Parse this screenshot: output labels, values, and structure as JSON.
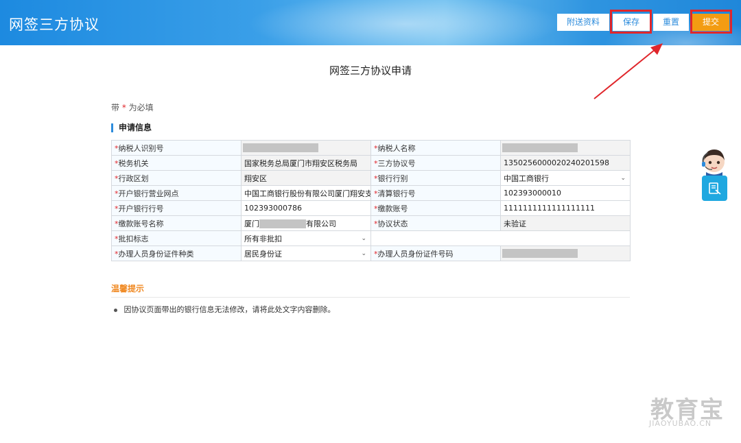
{
  "header": {
    "title": "网签三方协议",
    "buttons": {
      "attach": "附送资料",
      "save": "保存",
      "reset": "重置",
      "submit": "提交"
    }
  },
  "page": {
    "title": "网签三方协议申请",
    "required_note_prefix": "带",
    "required_star": "*",
    "required_note_suffix": "为必填",
    "section_title": "申请信息"
  },
  "form": {
    "rows": [
      [
        {
          "label": "纳税人识别号",
          "value": "",
          "masked": true,
          "readonly": true
        },
        {
          "label": "纳税人名称",
          "value": "",
          "masked": true,
          "readonly": true
        }
      ],
      [
        {
          "label": "税务机关",
          "value": "国家税务总局厦门市翔安区税务局",
          "readonly": true
        },
        {
          "label": "三方协议号",
          "value": "13502560000202402015​98",
          "readonly": true
        }
      ],
      [
        {
          "label": "行政区划",
          "value": "翔安区",
          "readonly": true
        },
        {
          "label": "银行行别",
          "value": "中国工商银行",
          "select": true
        }
      ],
      [
        {
          "label": "开户银行营业网点",
          "value": "中国工商银行股份有限公司厦门翔安支行"
        },
        {
          "label": "清算银行号",
          "value": "102393000010"
        }
      ],
      [
        {
          "label": "开户银行行号",
          "value": "102393000786"
        },
        {
          "label": "缴款账号",
          "value": "1111111111111111111"
        }
      ],
      [
        {
          "label": "缴款账号名称",
          "value_prefix": "厦门",
          "value_suffix": "有限公司",
          "partial_mask": true
        },
        {
          "label": "协议状态",
          "value": "未验证",
          "readonly": true
        }
      ],
      [
        {
          "label": "批扣标志",
          "value": "所有非批扣",
          "select": true
        },
        null
      ],
      [
        {
          "label": "办理人员身份证件种类",
          "value": "居民身份证",
          "select": true
        },
        {
          "label": "办理人员身份证件号码",
          "value": "",
          "masked": true,
          "readonly": true
        }
      ]
    ]
  },
  "tips": {
    "title": "温馨提示",
    "items": [
      "因协议页面带出的银行信息无法修改，请将此处文字内容删除。"
    ]
  },
  "watermark": {
    "cn": "教育宝",
    "en": "JIAOYUBAO.CN"
  },
  "colors": {
    "header_blue": "#1d8ae0",
    "submit_orange": "#f39c12",
    "required_red": "#e0262b",
    "annotation_red": "#e0262b",
    "tips_orange": "#f08a24"
  },
  "icons": {
    "avatar": "customer-service-avatar-icon",
    "chat": "chat-icon",
    "select": "chevron-down-icon"
  }
}
